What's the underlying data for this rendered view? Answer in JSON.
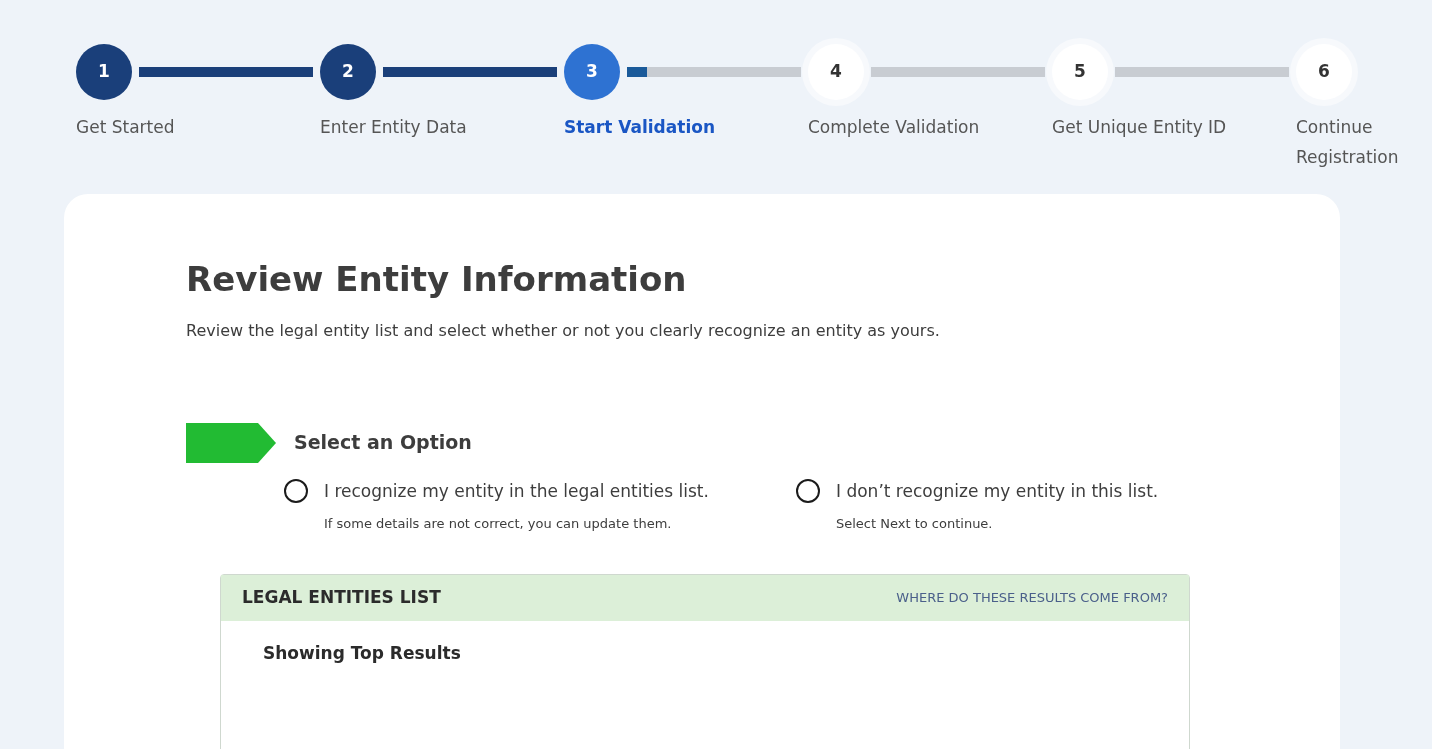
{
  "steps": [
    {
      "number": "1",
      "label": "Get Started",
      "completed": true,
      "selected": false
    },
    {
      "number": "2",
      "label": "Enter Entity Data",
      "completed": true,
      "selected": false
    },
    {
      "number": "3",
      "label": "Start Validation",
      "completed": false,
      "selected": true
    },
    {
      "number": "4",
      "label": "Complete Validation",
      "completed": false,
      "selected": false
    },
    {
      "number": "5",
      "label": "Get Unique Entity ID",
      "completed": false,
      "selected": false
    },
    {
      "number": "6",
      "label": "Continue Registration",
      "completed": false,
      "selected": false
    }
  ],
  "card": {
    "title": "Review Entity Information",
    "description": "Review the legal entity list and select whether or not you clearly recognize an entity as yours.",
    "section_title": "Select an Option",
    "options": [
      {
        "label": "I recognize my entity in the legal entities list.",
        "hint": "If some details are not correct, you can update them.",
        "selected": false
      },
      {
        "label": "I don’t recognize my entity in this list.",
        "hint": "Select Next to continue.",
        "selected": false
      }
    ],
    "list": {
      "title": "LEGAL ENTITIES LIST",
      "link": "WHERE DO THESE RESULTS COME FROM?",
      "subtitle": "Showing Top Results"
    }
  }
}
